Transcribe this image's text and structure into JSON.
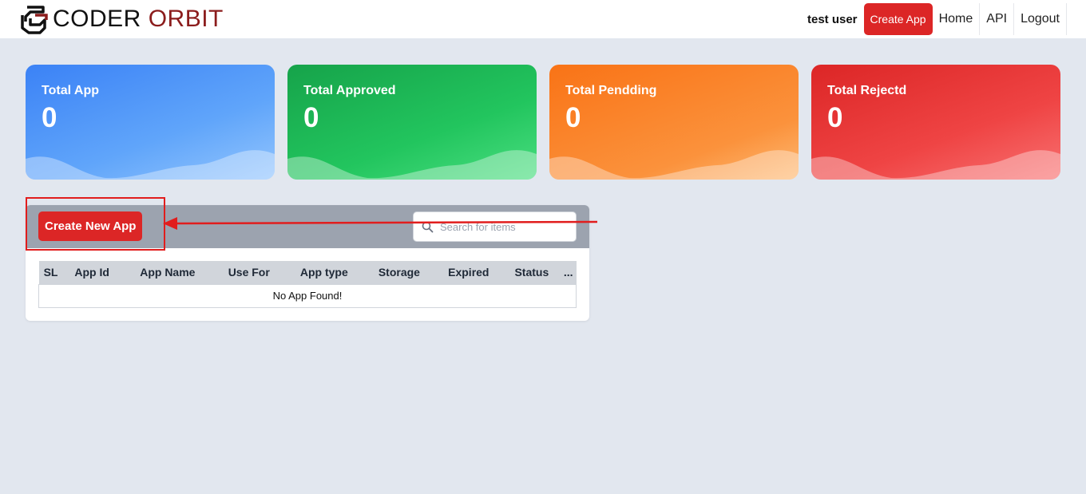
{
  "header": {
    "brand_word1": "CODER",
    "brand_word2": "ORBIT",
    "user_name": "test user",
    "create_app_label": "Create App",
    "nav": [
      "Home",
      "API",
      "Logout"
    ]
  },
  "stats": [
    {
      "label": "Total App",
      "value": "0",
      "color": "#3b82f6"
    },
    {
      "label": "Total Approved",
      "value": "0",
      "color": "#22c55e"
    },
    {
      "label": "Total Pendding",
      "value": "0",
      "color": "#f97316"
    },
    {
      "label": "Total Rejectd",
      "value": "0",
      "color": "#ef4444"
    }
  ],
  "panel": {
    "create_button_label": "Create New App",
    "search_placeholder": "Search for items",
    "search_value": "",
    "columns": [
      "SL",
      "App Id",
      "App Name",
      "Use For",
      "App type",
      "Storage",
      "Expired",
      "Status",
      "..."
    ],
    "empty_message": "No App Found!"
  },
  "colors": {
    "accent_red": "#dc2626",
    "page_bg": "#e2e7ef",
    "panel_header": "#9ca3af"
  }
}
